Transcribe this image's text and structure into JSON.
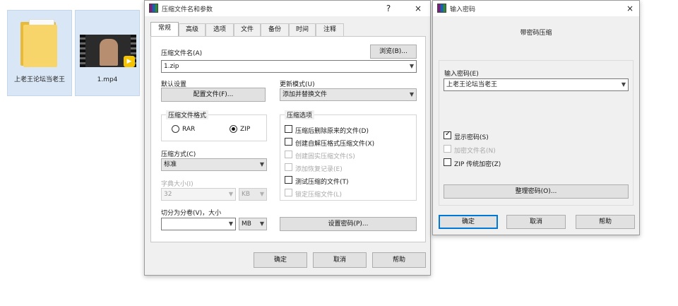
{
  "desktop": {
    "icons": [
      {
        "label": "上老王论坛当老王",
        "type": "folder"
      },
      {
        "label": "1.mp4",
        "type": "video"
      }
    ]
  },
  "archive_dialog": {
    "title": "压缩文件名和参数",
    "help_glyph": "?",
    "close_glyph": "×",
    "tabs": [
      "常规",
      "高级",
      "选项",
      "文件",
      "备份",
      "时间",
      "注释"
    ],
    "active_tab": 0,
    "archive_name_label": "压缩文件名(A)",
    "browse_button": "浏览(B)...",
    "archive_name_value": "1.zip",
    "default_settings_label": "默认设置",
    "profiles_button": "配置文件(F)...",
    "update_mode_label": "更新模式(U)",
    "update_mode_value": "添加并替换文件",
    "format_group_title": "压缩文件格式",
    "format_options": [
      "RAR",
      "ZIP"
    ],
    "format_selected": "ZIP",
    "options_group_title": "压缩选项",
    "options": [
      {
        "label": "压缩后删除原来的文件(D)",
        "checked": false,
        "enabled": true
      },
      {
        "label": "创建自解压格式压缩文件(X)",
        "checked": false,
        "enabled": true
      },
      {
        "label": "创建固实压缩文件(S)",
        "checked": false,
        "enabled": false
      },
      {
        "label": "添加恢复记录(E)",
        "checked": false,
        "enabled": false
      },
      {
        "label": "测试压缩的文件(T)",
        "checked": false,
        "enabled": true
      },
      {
        "label": "锁定压缩文件(L)",
        "checked": false,
        "enabled": false
      }
    ],
    "method_label": "压缩方式(C)",
    "method_value": "标准",
    "dict_label": "字典大小(I)",
    "dict_value": "32",
    "dict_unit": "KB",
    "split_label": "切分为分卷(V)，大小",
    "split_value": "",
    "split_unit": "MB",
    "set_password_button": "设置密码(P)...",
    "ok_button": "确定",
    "cancel_button": "取消",
    "help_button": "帮助"
  },
  "password_dialog": {
    "title": "输入密码",
    "close_glyph": "×",
    "heading": "带密码压缩",
    "enter_password_label": "输入密码(E)",
    "password_value": "上老王论坛当老王",
    "show_password_label": "显示密码(S)",
    "show_password_checked": true,
    "encrypt_names_label": "加密文件名(N)",
    "encrypt_names_enabled": false,
    "zip_legacy_label": "ZIP 传统加密(Z)",
    "zip_legacy_checked": false,
    "organize_button": "整理密码(O)...",
    "ok_button": "确定",
    "cancel_button": "取消",
    "help_button": "帮助"
  },
  "colors": {
    "accent": "#0078d7",
    "folder": "#f3c64c",
    "selection": "#d9e6f5"
  }
}
